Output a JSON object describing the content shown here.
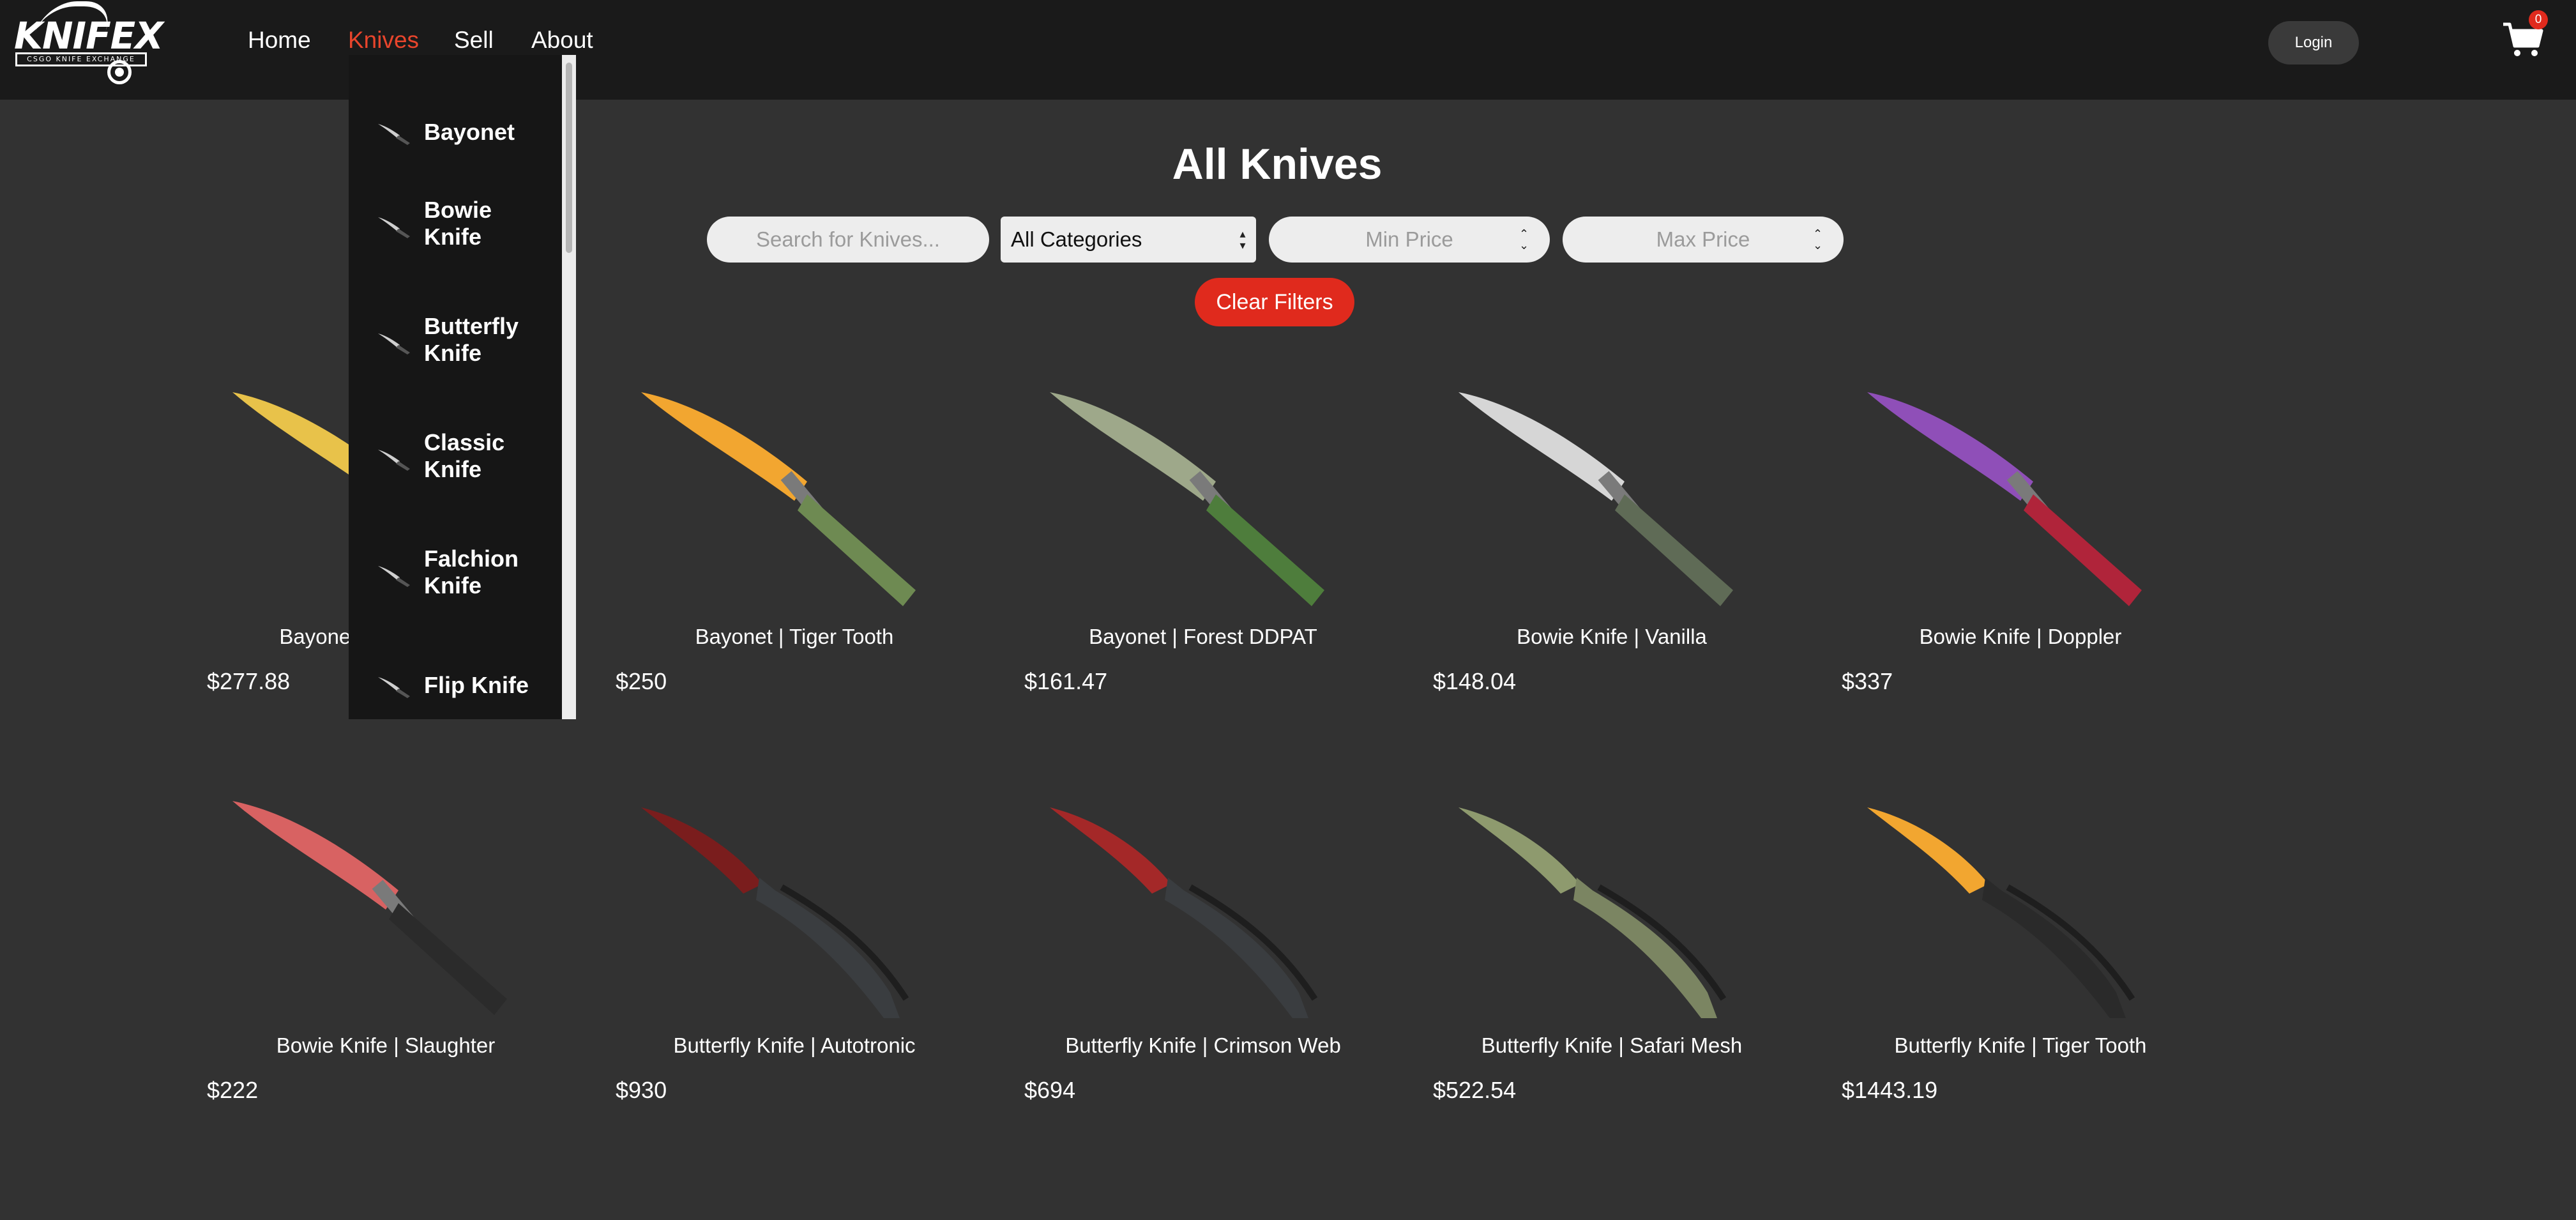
{
  "brand": {
    "logo_text": "KNIFEX",
    "logo_sub": "CSGO KNIFE EXCHANGE"
  },
  "nav": {
    "home": "Home",
    "knives": "Knives",
    "sell": "Sell",
    "about": "About"
  },
  "header": {
    "login": "Login",
    "cart_count": "0"
  },
  "page": {
    "title": "All Knives"
  },
  "filters": {
    "search_placeholder": "Search for Knives...",
    "category_selected": "All Categories",
    "min_price_placeholder": "Min Price",
    "max_price_placeholder": "Max Price",
    "clear_label": "Clear Filters"
  },
  "dropdown": {
    "items": [
      {
        "label": "Bayonet"
      },
      {
        "label": "Bowie Knife"
      },
      {
        "label": "Butterfly Knife"
      },
      {
        "label": "Classic Knife"
      },
      {
        "label": "Falchion Knife"
      },
      {
        "label": "Flip Knife"
      }
    ]
  },
  "products": [
    {
      "name": "Bayonet | Marble Fade",
      "price": "$277.88",
      "colors": [
        "#e8c24a",
        "#3f55c8"
      ]
    },
    {
      "name": "Bayonet | Tiger Tooth",
      "price": "$250",
      "colors": [
        "#f2a630",
        "#6e8a52"
      ]
    },
    {
      "name": "Bayonet | Forest DDPAT",
      "price": "$161.47",
      "colors": [
        "#9ea88a",
        "#4e7d3c"
      ]
    },
    {
      "name": "Bowie Knife | Vanilla",
      "price": "$148.04",
      "colors": [
        "#d6d6d6",
        "#5f6b56"
      ]
    },
    {
      "name": "Bowie Knife | Doppler",
      "price": "$337",
      "colors": [
        "#8f4fb8",
        "#b0243a"
      ]
    },
    {
      "name": "Bowie Knife | Slaughter",
      "price": "$222",
      "colors": [
        "#d86262",
        "#2b2b2b"
      ]
    },
    {
      "name": "Butterfly Knife | Autotronic",
      "price": "$930",
      "colors": [
        "#7a1d1d",
        "#3a3d40"
      ]
    },
    {
      "name": "Butterfly Knife | Crimson Web",
      "price": "$694",
      "colors": [
        "#a42828",
        "#3a3d40"
      ]
    },
    {
      "name": "Butterfly Knife | Safari Mesh",
      "price": "$522.54",
      "colors": [
        "#8e9a6e",
        "#7b8562"
      ]
    },
    {
      "name": "Butterfly Knife | Tiger Tooth",
      "price": "$1443.19",
      "colors": [
        "#f2a630",
        "#2a2a2a"
      ]
    }
  ]
}
